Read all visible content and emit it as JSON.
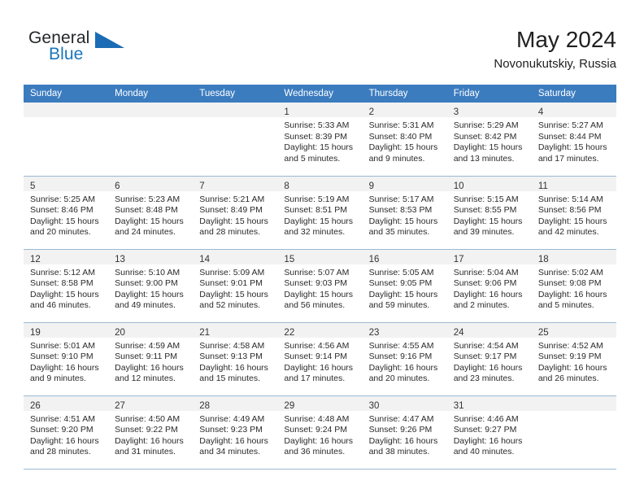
{
  "brand": {
    "name_part1": "General",
    "name_part2": "Blue",
    "logo_icon": "triangle-logo-icon",
    "accent_color": "#1b75bc"
  },
  "header": {
    "title": "May 2024",
    "subtitle": "Novonukutskiy, Russia"
  },
  "theme": {
    "header_row_color": "#3b7cbf",
    "daynum_strip_color": "#f2f2f2",
    "grid_line_color": "#9bb8d4",
    "text_color": "#2a2a2a"
  },
  "calendar": {
    "weekday_headers": [
      "Sunday",
      "Monday",
      "Tuesday",
      "Wednesday",
      "Thursday",
      "Friday",
      "Saturday"
    ],
    "weeks": [
      [
        {
          "empty": true
        },
        {
          "empty": true
        },
        {
          "empty": true
        },
        {
          "day": "1",
          "sunrise": "Sunrise: 5:33 AM",
          "sunset": "Sunset: 8:39 PM",
          "daylight_line1": "Daylight: 15 hours",
          "daylight_line2": "and 5 minutes."
        },
        {
          "day": "2",
          "sunrise": "Sunrise: 5:31 AM",
          "sunset": "Sunset: 8:40 PM",
          "daylight_line1": "Daylight: 15 hours",
          "daylight_line2": "and 9 minutes."
        },
        {
          "day": "3",
          "sunrise": "Sunrise: 5:29 AM",
          "sunset": "Sunset: 8:42 PM",
          "daylight_line1": "Daylight: 15 hours",
          "daylight_line2": "and 13 minutes."
        },
        {
          "day": "4",
          "sunrise": "Sunrise: 5:27 AM",
          "sunset": "Sunset: 8:44 PM",
          "daylight_line1": "Daylight: 15 hours",
          "daylight_line2": "and 17 minutes."
        }
      ],
      [
        {
          "day": "5",
          "sunrise": "Sunrise: 5:25 AM",
          "sunset": "Sunset: 8:46 PM",
          "daylight_line1": "Daylight: 15 hours",
          "daylight_line2": "and 20 minutes."
        },
        {
          "day": "6",
          "sunrise": "Sunrise: 5:23 AM",
          "sunset": "Sunset: 8:48 PM",
          "daylight_line1": "Daylight: 15 hours",
          "daylight_line2": "and 24 minutes."
        },
        {
          "day": "7",
          "sunrise": "Sunrise: 5:21 AM",
          "sunset": "Sunset: 8:49 PM",
          "daylight_line1": "Daylight: 15 hours",
          "daylight_line2": "and 28 minutes."
        },
        {
          "day": "8",
          "sunrise": "Sunrise: 5:19 AM",
          "sunset": "Sunset: 8:51 PM",
          "daylight_line1": "Daylight: 15 hours",
          "daylight_line2": "and 32 minutes."
        },
        {
          "day": "9",
          "sunrise": "Sunrise: 5:17 AM",
          "sunset": "Sunset: 8:53 PM",
          "daylight_line1": "Daylight: 15 hours",
          "daylight_line2": "and 35 minutes."
        },
        {
          "day": "10",
          "sunrise": "Sunrise: 5:15 AM",
          "sunset": "Sunset: 8:55 PM",
          "daylight_line1": "Daylight: 15 hours",
          "daylight_line2": "and 39 minutes."
        },
        {
          "day": "11",
          "sunrise": "Sunrise: 5:14 AM",
          "sunset": "Sunset: 8:56 PM",
          "daylight_line1": "Daylight: 15 hours",
          "daylight_line2": "and 42 minutes."
        }
      ],
      [
        {
          "day": "12",
          "sunrise": "Sunrise: 5:12 AM",
          "sunset": "Sunset: 8:58 PM",
          "daylight_line1": "Daylight: 15 hours",
          "daylight_line2": "and 46 minutes."
        },
        {
          "day": "13",
          "sunrise": "Sunrise: 5:10 AM",
          "sunset": "Sunset: 9:00 PM",
          "daylight_line1": "Daylight: 15 hours",
          "daylight_line2": "and 49 minutes."
        },
        {
          "day": "14",
          "sunrise": "Sunrise: 5:09 AM",
          "sunset": "Sunset: 9:01 PM",
          "daylight_line1": "Daylight: 15 hours",
          "daylight_line2": "and 52 minutes."
        },
        {
          "day": "15",
          "sunrise": "Sunrise: 5:07 AM",
          "sunset": "Sunset: 9:03 PM",
          "daylight_line1": "Daylight: 15 hours",
          "daylight_line2": "and 56 minutes."
        },
        {
          "day": "16",
          "sunrise": "Sunrise: 5:05 AM",
          "sunset": "Sunset: 9:05 PM",
          "daylight_line1": "Daylight: 15 hours",
          "daylight_line2": "and 59 minutes."
        },
        {
          "day": "17",
          "sunrise": "Sunrise: 5:04 AM",
          "sunset": "Sunset: 9:06 PM",
          "daylight_line1": "Daylight: 16 hours",
          "daylight_line2": "and 2 minutes."
        },
        {
          "day": "18",
          "sunrise": "Sunrise: 5:02 AM",
          "sunset": "Sunset: 9:08 PM",
          "daylight_line1": "Daylight: 16 hours",
          "daylight_line2": "and 5 minutes."
        }
      ],
      [
        {
          "day": "19",
          "sunrise": "Sunrise: 5:01 AM",
          "sunset": "Sunset: 9:10 PM",
          "daylight_line1": "Daylight: 16 hours",
          "daylight_line2": "and 9 minutes."
        },
        {
          "day": "20",
          "sunrise": "Sunrise: 4:59 AM",
          "sunset": "Sunset: 9:11 PM",
          "daylight_line1": "Daylight: 16 hours",
          "daylight_line2": "and 12 minutes."
        },
        {
          "day": "21",
          "sunrise": "Sunrise: 4:58 AM",
          "sunset": "Sunset: 9:13 PM",
          "daylight_line1": "Daylight: 16 hours",
          "daylight_line2": "and 15 minutes."
        },
        {
          "day": "22",
          "sunrise": "Sunrise: 4:56 AM",
          "sunset": "Sunset: 9:14 PM",
          "daylight_line1": "Daylight: 16 hours",
          "daylight_line2": "and 17 minutes."
        },
        {
          "day": "23",
          "sunrise": "Sunrise: 4:55 AM",
          "sunset": "Sunset: 9:16 PM",
          "daylight_line1": "Daylight: 16 hours",
          "daylight_line2": "and 20 minutes."
        },
        {
          "day": "24",
          "sunrise": "Sunrise: 4:54 AM",
          "sunset": "Sunset: 9:17 PM",
          "daylight_line1": "Daylight: 16 hours",
          "daylight_line2": "and 23 minutes."
        },
        {
          "day": "25",
          "sunrise": "Sunrise: 4:52 AM",
          "sunset": "Sunset: 9:19 PM",
          "daylight_line1": "Daylight: 16 hours",
          "daylight_line2": "and 26 minutes."
        }
      ],
      [
        {
          "day": "26",
          "sunrise": "Sunrise: 4:51 AM",
          "sunset": "Sunset: 9:20 PM",
          "daylight_line1": "Daylight: 16 hours",
          "daylight_line2": "and 28 minutes."
        },
        {
          "day": "27",
          "sunrise": "Sunrise: 4:50 AM",
          "sunset": "Sunset: 9:22 PM",
          "daylight_line1": "Daylight: 16 hours",
          "daylight_line2": "and 31 minutes."
        },
        {
          "day": "28",
          "sunrise": "Sunrise: 4:49 AM",
          "sunset": "Sunset: 9:23 PM",
          "daylight_line1": "Daylight: 16 hours",
          "daylight_line2": "and 34 minutes."
        },
        {
          "day": "29",
          "sunrise": "Sunrise: 4:48 AM",
          "sunset": "Sunset: 9:24 PM",
          "daylight_line1": "Daylight: 16 hours",
          "daylight_line2": "and 36 minutes."
        },
        {
          "day": "30",
          "sunrise": "Sunrise: 4:47 AM",
          "sunset": "Sunset: 9:26 PM",
          "daylight_line1": "Daylight: 16 hours",
          "daylight_line2": "and 38 minutes."
        },
        {
          "day": "31",
          "sunrise": "Sunrise: 4:46 AM",
          "sunset": "Sunset: 9:27 PM",
          "daylight_line1": "Daylight: 16 hours",
          "daylight_line2": "and 40 minutes."
        },
        {
          "empty": true
        }
      ]
    ]
  }
}
